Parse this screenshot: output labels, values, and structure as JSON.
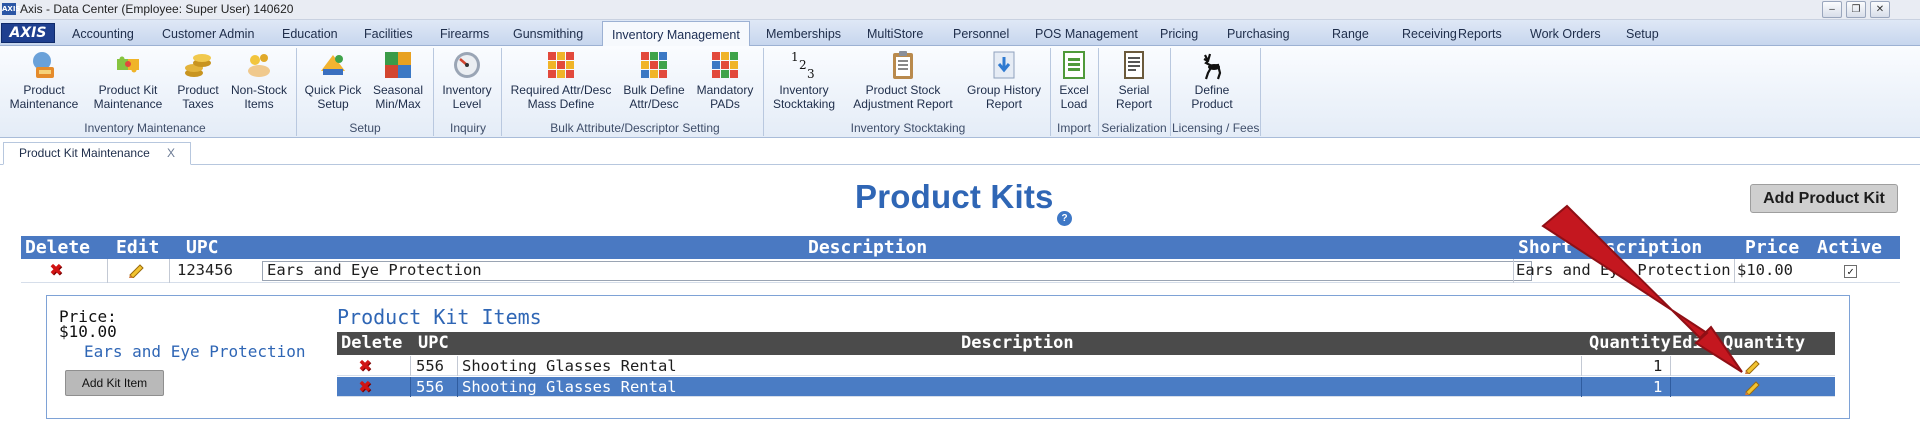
{
  "window": {
    "app_icon_text": "AXIS",
    "title": "Axis - Data Center  (Employee: Super User) 140620",
    "minimize": "‒",
    "maximize": "❐",
    "close": "✕"
  },
  "menu": {
    "logo": "AXIS",
    "tabs": [
      "Accounting",
      "Customer Admin",
      "Education",
      "Facilities",
      "Firearms",
      "Gunsmithing",
      "Inventory Management",
      "Memberships",
      "MultiStore",
      "Personnel",
      "POS Management",
      "Pricing",
      "Purchasing",
      "Range",
      "Receiving",
      "Reports",
      "Work Orders",
      "Setup"
    ],
    "active_tab": "Inventory Management"
  },
  "ribbon": {
    "items": [
      {
        "line1": "Product",
        "line2": "Maintenance",
        "icon": "product-maintenance-icon"
      },
      {
        "line1": "Product Kit",
        "line2": "Maintenance",
        "icon": "puzzle-icon"
      },
      {
        "line1": "Product",
        "line2": "Taxes",
        "icon": "coins-icon"
      },
      {
        "line1": "Non-Stock",
        "line2": "Items",
        "icon": "hand-icon"
      },
      {
        "line1": "Quick Pick",
        "line2": "Setup",
        "icon": "quick-pick-icon"
      },
      {
        "line1": "Seasonal",
        "line2": "Min/Max",
        "icon": "seasons-icon"
      },
      {
        "line1": "Inventory",
        "line2": "Level",
        "icon": "gauge-icon"
      },
      {
        "line1": "Required Attr/Desc",
        "line2": "Mass Define",
        "icon": "grid-icon"
      },
      {
        "line1": "Bulk Define",
        "line2": "Attr/Desc",
        "icon": "grid-icon"
      },
      {
        "line1": "Mandatory",
        "line2": "PADs",
        "icon": "grid-icon"
      },
      {
        "line1": "Inventory",
        "line2": "Stocktaking",
        "icon": "numbers-icon"
      },
      {
        "line1": "Product Stock",
        "line2": "Adjustment Report",
        "icon": "clipboard-icon"
      },
      {
        "line1": "Group History",
        "line2": "Report",
        "icon": "download-icon"
      },
      {
        "line1": "Excel",
        "line2": "Load",
        "icon": "excel-icon"
      },
      {
        "line1": "Serial",
        "line2": "Report",
        "icon": "report-icon"
      },
      {
        "line1": "Define",
        "line2": "Product",
        "icon": "deer-icon"
      }
    ],
    "groups": [
      "Inventory Maintenance",
      "Setup",
      "Inquiry",
      "Bulk Attribute/Descriptor Setting",
      "Inventory Stocktaking",
      "Import",
      "Serialization",
      "Licensing / Fees"
    ]
  },
  "doc_tab": {
    "label": "Product Kit Maintenance",
    "close": "X"
  },
  "page": {
    "title": "Product Kits",
    "help": "?",
    "add_kit_button": "Add Product Kit"
  },
  "kits_table": {
    "headers": {
      "delete": "Delete",
      "edit": "Edit",
      "upc": "UPC",
      "description": "Description",
      "short_desc": "Short Description",
      "price": "Price",
      "active": "Active"
    },
    "rows": [
      {
        "upc": "123456",
        "description": "Ears and Eye Protection",
        "short_desc": "Ears and Eye Protection",
        "price": "$10.00",
        "active": true,
        "active_mark": "✓"
      }
    ]
  },
  "kit_detail": {
    "price_label": "Price:",
    "price_value": "$10.00",
    "description": "Ears and Eye Protection",
    "add_item_button": "Add Kit Item",
    "items_title": "Product Kit Items",
    "headers": {
      "delete": "Delete",
      "upc": "UPC",
      "description": "Description",
      "quantity": "Quantity",
      "edit_quantity": "Edit Quantity"
    },
    "rows": [
      {
        "upc": "556",
        "description": "Shooting Glasses Rental",
        "quantity": "1",
        "selected": false
      },
      {
        "upc": "556",
        "description": "Shooting Glasses Rental",
        "quantity": "1",
        "selected": true
      }
    ]
  },
  "colors": {
    "accent_blue": "#2f66b5",
    "header_blue": "#4a79c2",
    "items_header": "#4b4b4b",
    "annotation_arrow": "#c4171f"
  }
}
